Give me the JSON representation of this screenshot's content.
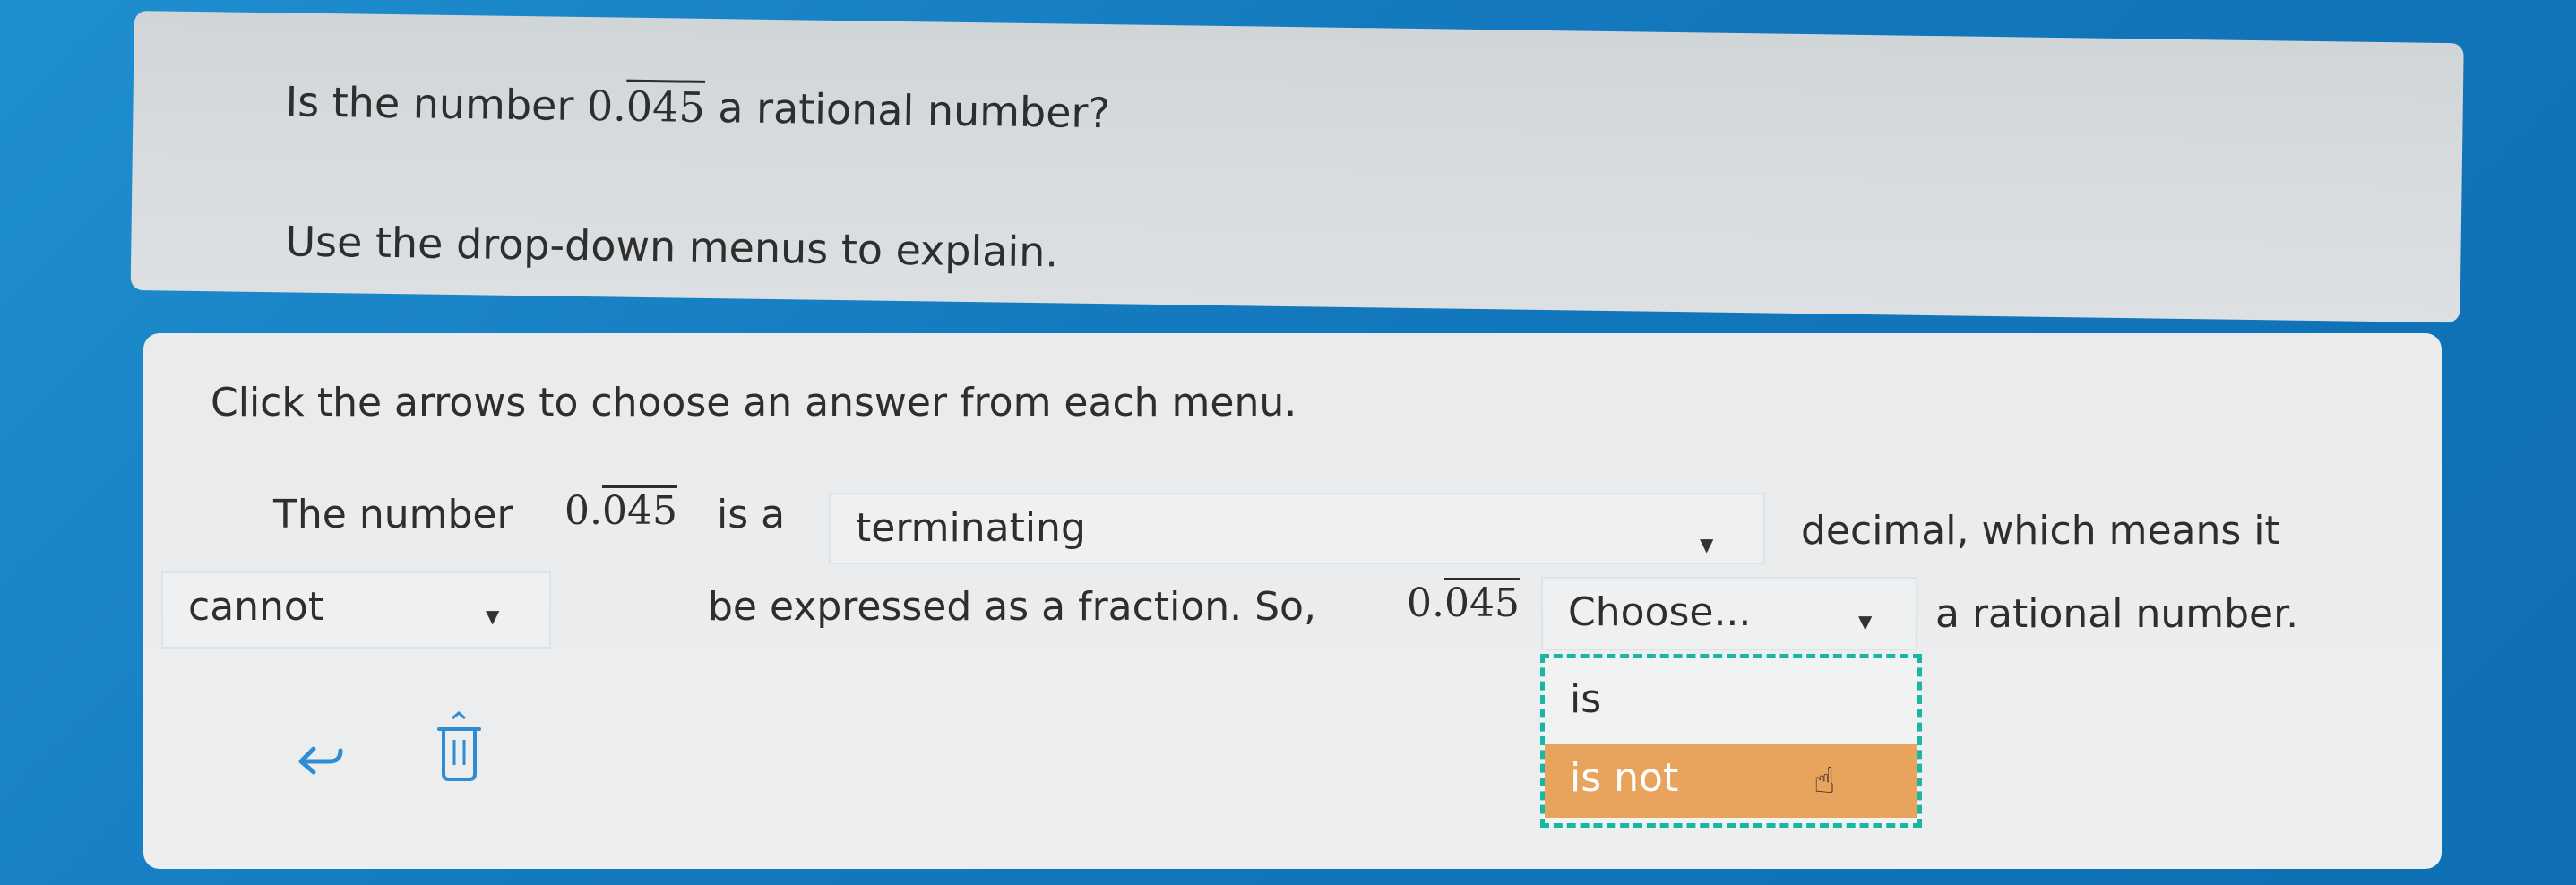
{
  "question": {
    "prefix": "Is the number",
    "number_int": "0.",
    "number_rep": "045",
    "suffix": "a rational number?",
    "instruction": "Use the drop-down menus to explain."
  },
  "answer": {
    "instruction": "Click the arrows to choose an answer from each menu.",
    "s1_prefix": "The number",
    "s1_num_int": "0.",
    "s1_num_rep": "045",
    "s1_is_a": "is a",
    "dropdown1_value": "terminating",
    "s1_after": "decimal, which means it",
    "dropdown2_value": "cannot",
    "s2_text": "be expressed as a fraction. So,",
    "s2_num_int": "0.",
    "s2_num_rep": "045",
    "dropdown3_value": "Choose...",
    "s2_end": "a rational number.",
    "menu_options": [
      "is",
      "is not"
    ],
    "menu_highlighted": "is not"
  },
  "icons": {
    "undo": "undo-icon",
    "clear": "trash-icon",
    "dropdown": "caret-down-icon",
    "pointer": "hand-pointer-icon"
  },
  "colors": {
    "highlight": "#e8a35c",
    "focus_outline": "#19b6a6",
    "background": "#1378bd"
  }
}
